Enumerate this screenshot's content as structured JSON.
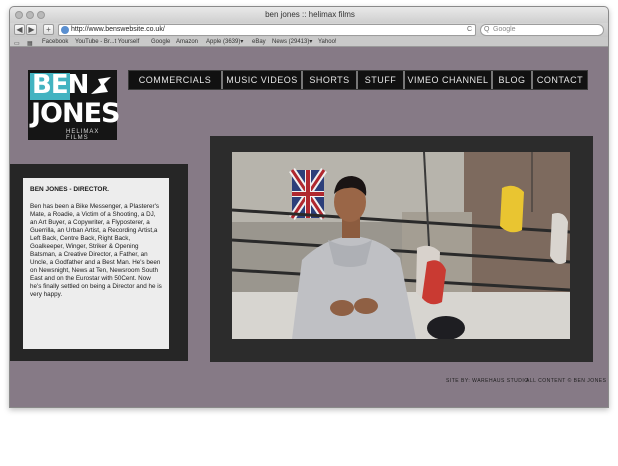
{
  "browser": {
    "window_title": "ben jones :: helimax films",
    "url": "http://www.benswebsite.co.uk/",
    "search_placeholder": "Google",
    "back_glyph": "◀",
    "forward_glyph": "▶",
    "add_glyph": "+",
    "reload_glyph": "C",
    "search_glyph": "Q",
    "bookmarks": [
      "Facebook",
      "YouTube - Br...t Yourself",
      "Google",
      "Amazon",
      "Apple (3639)▾",
      "eBay",
      "News (29413)▾",
      "Yahoo!"
    ]
  },
  "logo": {
    "line1": "BEN",
    "line2": "JONES",
    "tagline": "HELIMAX FILMS",
    "accent_color": "#43b3c1"
  },
  "nav": {
    "items": [
      "COMMERCIALS",
      "MUSIC VIDEOS",
      "SHORTS",
      "STUFF",
      "VIMEO CHANNEL",
      "BLOG",
      "CONTACT"
    ]
  },
  "bio": {
    "heading": "BEN JONES - DIRECTOR.",
    "body": "Ben has been a Bike Messenger, a Plasterer's Mate, a Roadie, a Victim of a Shooting, a DJ, an Art Buyer, a Copywriter, a Flyposterer, a Guerrilla, an Urban Artist, a Recording Artist,a Left Back, Centre Back, Right Back, Goalkeeper, Winger, Striker & Opening Batsman, a Creative Director, a Father, an Uncle, a Godfather and a Best Man. He's been on Newsnight, News at Ten, Newsroom South East and on the Eurostar with 50Cent. Now he's finally settled on being a Director and he is very happy."
  },
  "footer": {
    "site_credit": "SITE BY: WAREHAUS STUDIO",
    "copyright": "ALL CONTENT © BEN JONES"
  },
  "colors": {
    "page_background": "#867a86",
    "frame": "#262626",
    "card": "#ededed"
  }
}
